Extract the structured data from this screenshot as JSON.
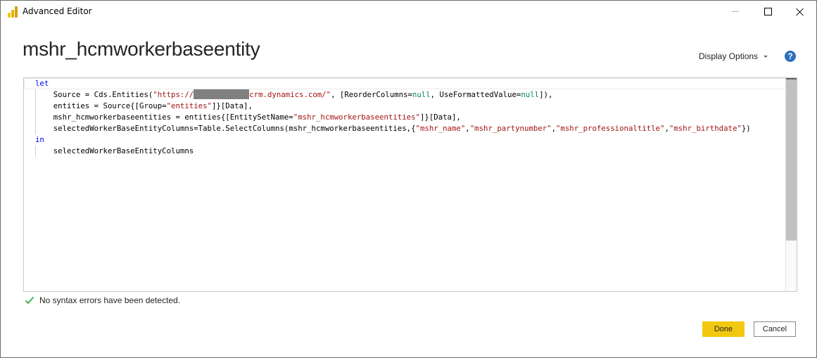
{
  "window": {
    "title": "Advanced Editor",
    "app_icon": "power-bi-icon",
    "controls": {
      "minimize": "minimize-icon",
      "maximize": "maximize-icon",
      "close": "close-icon"
    }
  },
  "header": {
    "query_name": "mshr_hcmworkerbaseentity",
    "display_options_label": "Display Options",
    "help_icon": "?"
  },
  "editor": {
    "lines": [
      {
        "indent": 0,
        "tokens": [
          {
            "t": "kw",
            "v": "let"
          }
        ]
      },
      {
        "indent": 1,
        "tokens": [
          {
            "t": "plain",
            "v": "Source = Cds.Entities("
          },
          {
            "t": "str",
            "v": "\"https://"
          },
          {
            "t": "redact",
            "v": ""
          },
          {
            "t": "str",
            "v": "crm.dynamics.com/\""
          },
          {
            "t": "plain",
            "v": ", [ReorderColumns="
          },
          {
            "t": "nul",
            "v": "null"
          },
          {
            "t": "plain",
            "v": ", UseFormattedValue="
          },
          {
            "t": "nul",
            "v": "null"
          },
          {
            "t": "plain",
            "v": "]),"
          }
        ]
      },
      {
        "indent": 1,
        "tokens": [
          {
            "t": "plain",
            "v": "entities = Source{[Group="
          },
          {
            "t": "str",
            "v": "\"entities\""
          },
          {
            "t": "plain",
            "v": "]}[Data],"
          }
        ]
      },
      {
        "indent": 1,
        "tokens": [
          {
            "t": "plain",
            "v": "mshr_hcmworkerbaseentities = entities{[EntitySetName="
          },
          {
            "t": "str",
            "v": "\"mshr_hcmworkerbaseentities\""
          },
          {
            "t": "plain",
            "v": "]}[Data],"
          }
        ]
      },
      {
        "indent": 1,
        "tokens": [
          {
            "t": "plain",
            "v": "selectedWorkerBaseEntityColumns=Table.SelectColumns(mshr_hcmworkerbaseentities,{"
          },
          {
            "t": "str",
            "v": "\"mshr_name\""
          },
          {
            "t": "plain",
            "v": ","
          },
          {
            "t": "str",
            "v": "\"mshr_partynumber\""
          },
          {
            "t": "plain",
            "v": ","
          },
          {
            "t": "str",
            "v": "\"mshr_professionaltitle\""
          },
          {
            "t": "plain",
            "v": ","
          },
          {
            "t": "str",
            "v": "\"mshr_birthdate\""
          },
          {
            "t": "plain",
            "v": "})"
          }
        ]
      },
      {
        "indent": 0,
        "tokens": [
          {
            "t": "kw",
            "v": "in"
          }
        ]
      },
      {
        "indent": 1,
        "tokens": [
          {
            "t": "plain",
            "v": "selectedWorkerBaseEntityColumns"
          }
        ]
      }
    ],
    "colors": {
      "keyword": "#0000ff",
      "string": "#a31515",
      "null": "#098658"
    }
  },
  "status": {
    "icon": "checkmark-icon",
    "text": "No syntax errors have been detected.",
    "color": "#4caf50"
  },
  "footer": {
    "done_label": "Done",
    "cancel_label": "Cancel",
    "done_color": "#f2c811"
  }
}
